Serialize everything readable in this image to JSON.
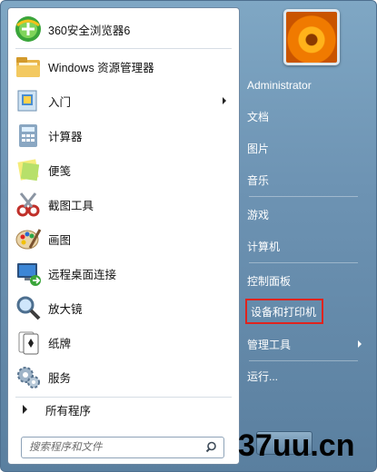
{
  "left_panel": {
    "items": [
      {
        "label": "360安全浏览器6",
        "icon": "browser-360-icon"
      },
      {
        "label": "Windows 资源管理器",
        "icon": "folder-explorer-icon"
      },
      {
        "label": "入门",
        "icon": "getting-started-icon",
        "has_submenu": true
      },
      {
        "label": "计算器",
        "icon": "calculator-icon"
      },
      {
        "label": "便笺",
        "icon": "sticky-notes-icon"
      },
      {
        "label": "截图工具",
        "icon": "scissors-icon"
      },
      {
        "label": "画图",
        "icon": "paint-palette-icon"
      },
      {
        "label": "远程桌面连接",
        "icon": "remote-desktop-icon"
      },
      {
        "label": "放大镜",
        "icon": "magnifier-icon"
      },
      {
        "label": "纸牌",
        "icon": "solitaire-cards-icon"
      },
      {
        "label": "服务",
        "icon": "services-gear-icon"
      }
    ],
    "all_programs": "所有程序",
    "search_placeholder": "搜索程序和文件"
  },
  "right_panel": {
    "items": [
      {
        "label": "Administrator"
      },
      {
        "label": "文档"
      },
      {
        "label": "图片"
      },
      {
        "label": "音乐"
      },
      {
        "label": "游戏"
      },
      {
        "label": "计算机"
      },
      {
        "label": "控制面板"
      },
      {
        "label": "设备和打印机",
        "highlighted": true
      },
      {
        "label": "管理工具",
        "has_submenu": true
      },
      {
        "label": "运行..."
      }
    ]
  },
  "watermark": "37uu.cn",
  "colors": {
    "highlight_border": "#e0231d",
    "right_panel_bg": "#6d93b3"
  }
}
